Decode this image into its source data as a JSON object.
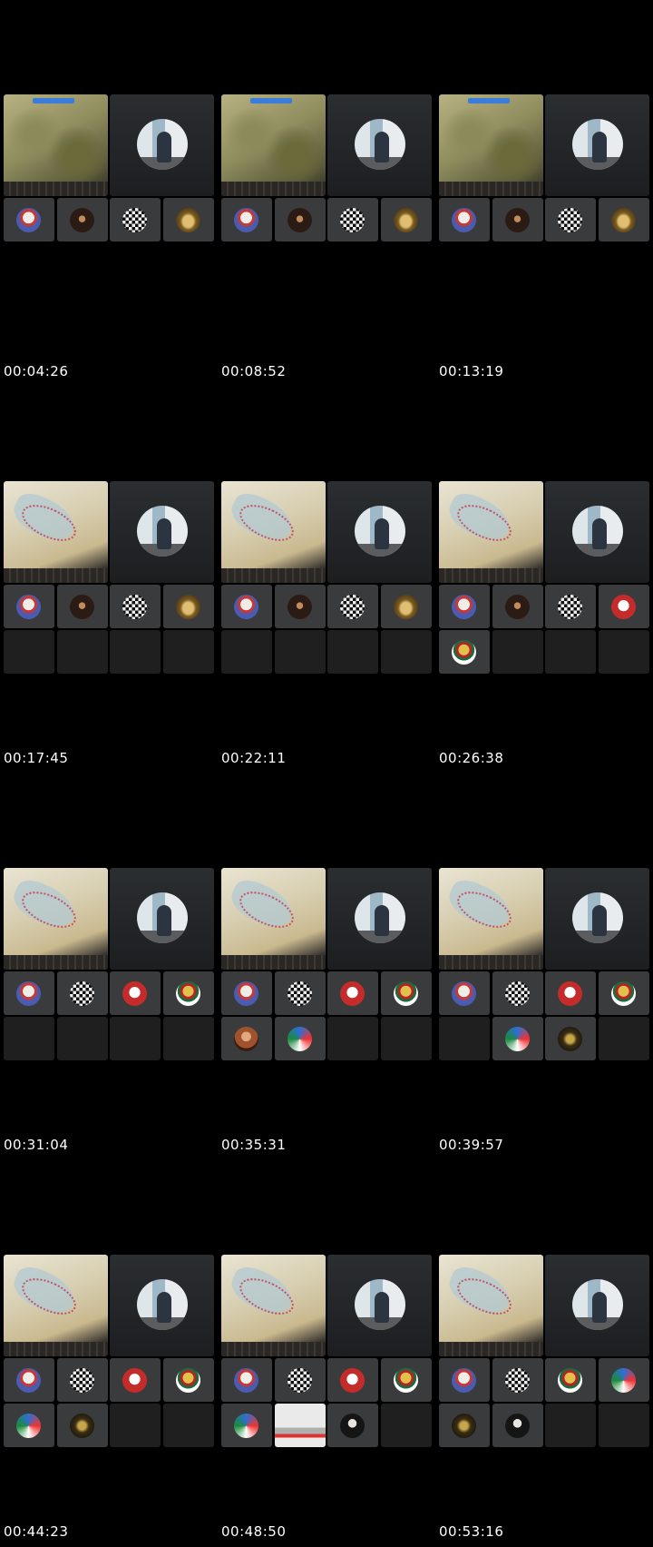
{
  "contact_sheet": {
    "thumbnails": [
      {
        "time": "00:04:26",
        "screen": "satellite-map",
        "participants": [
          "flag-person",
          "dark-person",
          "pattern",
          "gold"
        ]
      },
      {
        "time": "00:08:52",
        "screen": "satellite-map",
        "participants": [
          "flag-person",
          "dark-person",
          "pattern",
          "gold"
        ]
      },
      {
        "time": "00:13:19",
        "screen": "satellite-map",
        "participants": [
          "flag-person",
          "dark-person",
          "pattern",
          "gold"
        ]
      },
      {
        "time": "00:17:45",
        "screen": "coastline-map",
        "participants": [
          "flag-person",
          "dark-person",
          "pattern",
          "gold",
          "empty",
          "empty",
          "empty",
          "empty"
        ]
      },
      {
        "time": "00:22:11",
        "screen": "coastline-map",
        "participants": [
          "flag-person",
          "dark-person",
          "pattern",
          "gold",
          "empty",
          "empty",
          "empty",
          "empty"
        ]
      },
      {
        "time": "00:26:38",
        "screen": "coastline-map",
        "participants": [
          "flag-person",
          "dark-person",
          "pattern",
          "red-person",
          "emblem",
          "empty",
          "empty",
          "empty"
        ]
      },
      {
        "time": "00:31:04",
        "screen": "coastline-map",
        "participants": [
          "flag-person",
          "pattern",
          "red-person",
          "emblem",
          "empty",
          "empty",
          "empty",
          "empty"
        ]
      },
      {
        "time": "00:35:31",
        "screen": "coastline-map",
        "participants": [
          "flag-person",
          "pattern",
          "red-person",
          "emblem",
          "woman",
          "ribbon",
          "empty",
          "empty"
        ]
      },
      {
        "time": "00:39:57",
        "screen": "coastline-map",
        "participants": [
          "flag-person",
          "pattern",
          "red-person",
          "emblem",
          "empty",
          "ribbon",
          "gold-dark",
          "empty"
        ]
      },
      {
        "time": "00:44:23",
        "screen": "coastline-map",
        "participants": [
          "flag-person",
          "pattern",
          "red-person",
          "emblem",
          "ribbon",
          "gold-dark",
          "empty",
          "empty"
        ]
      },
      {
        "time": "00:48:50",
        "screen": "coastline-map",
        "participants": [
          "flag-person",
          "pattern",
          "red-person",
          "emblem",
          "ribbon",
          "photo",
          "bw-person",
          "empty"
        ]
      },
      {
        "time": "00:53:16",
        "screen": "coastline-map",
        "participants": [
          "flag-person",
          "pattern",
          "emblem",
          "ribbon",
          "gold-dark",
          "bw-person",
          "empty",
          "empty"
        ]
      }
    ]
  }
}
